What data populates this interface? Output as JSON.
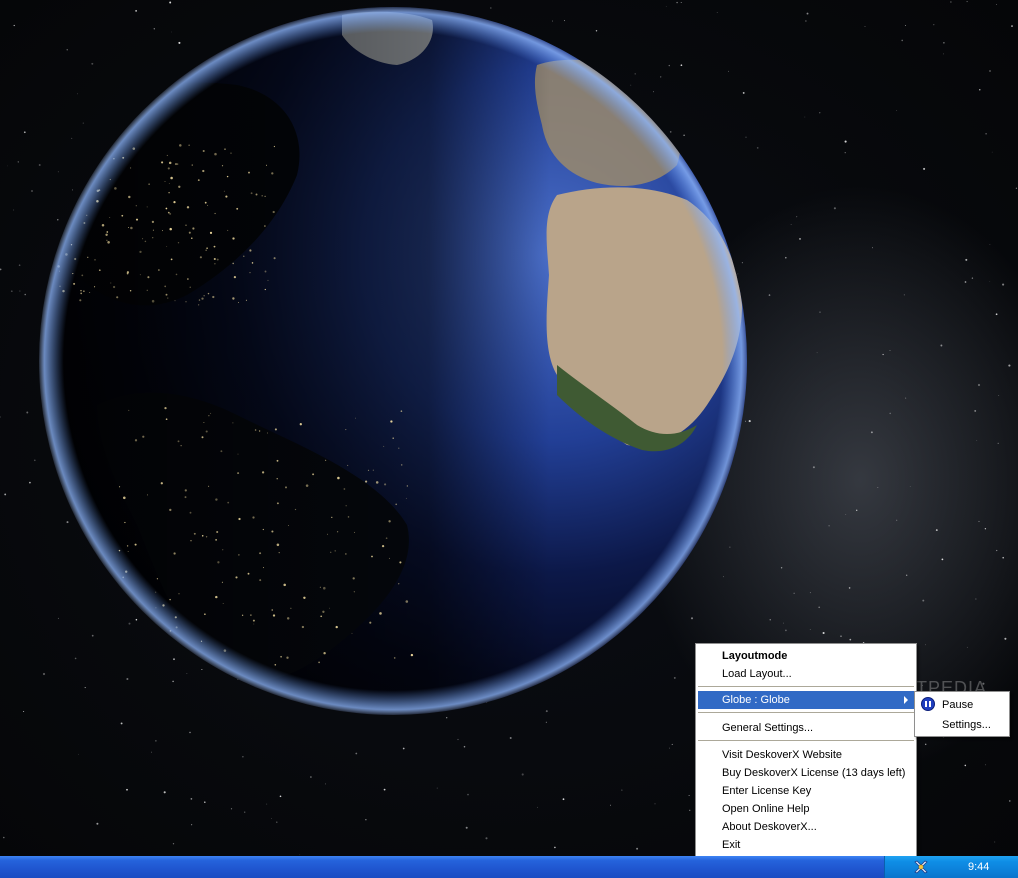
{
  "watermark": "SOFTPEDIA",
  "main_menu": {
    "items": [
      {
        "label": "Layoutmode",
        "bold": true
      },
      {
        "label": "Load Layout..."
      },
      {
        "label": "Globe : Globe",
        "highlighted": true,
        "has_submenu": true
      },
      {
        "label": "General Settings..."
      },
      {
        "label": "Visit DeskoverX Website"
      },
      {
        "label": "Buy DeskoverX License (13 days left)"
      },
      {
        "label": "Enter License Key"
      },
      {
        "label": "Open Online Help"
      },
      {
        "label": "About DeskoverX..."
      },
      {
        "label": "Exit"
      }
    ]
  },
  "sub_menu": {
    "items": [
      {
        "label": "Pause",
        "icon": "pause-icon"
      },
      {
        "label": "Settings..."
      }
    ]
  },
  "taskbar": {
    "clock": "9:44",
    "tray_icon": "deskoverx-tray-icon"
  },
  "colors": {
    "highlight": "#316ac5",
    "taskbar": "#2563dc",
    "tray": "#0f8ee6"
  }
}
